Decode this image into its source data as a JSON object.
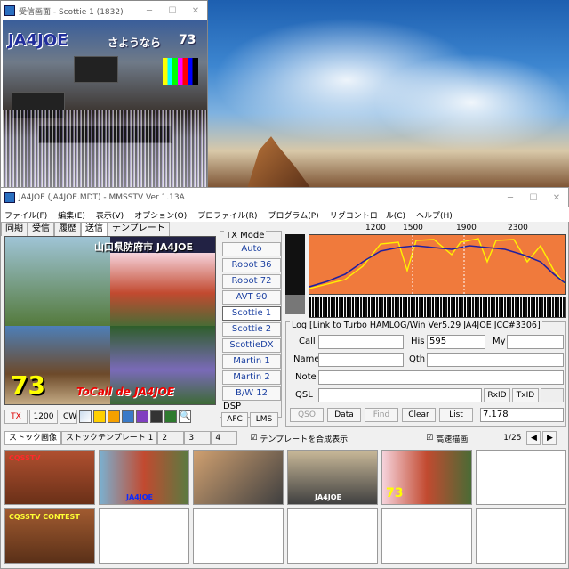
{
  "scottie_window": {
    "title": "受信画面 - Scottie 1 (1832)",
    "rx_text": "JA4JOE",
    "rx_text2": "さようなら",
    "rx_text3": "73"
  },
  "main_window": {
    "title": "JA4JOE (JA4JOE.MDT) - MMSSTV Ver 1.13A"
  },
  "menu": [
    "ファイル(F)",
    "編集(E)",
    "表示(V)",
    "オプション(O)",
    "プロファイル(R)",
    "プログラム(P)",
    "リグコントロール(C)",
    "ヘルプ(H)"
  ],
  "tabs": [
    "同期",
    "受信",
    "履歴",
    "送信",
    "テンプレート"
  ],
  "tx_image": {
    "title": "山口県防府市 JA4JOE",
    "big": "73",
    "tocall": "ToCall de JA4JOE"
  },
  "tx_controls": {
    "tx": "TX",
    "speed": "1200",
    "cw": "CW"
  },
  "tx_mode": {
    "label": "TX Mode",
    "modes": [
      "Auto",
      "Robot 36",
      "Robot 72",
      "AVT 90",
      "Scottie 1",
      "Scottie 2",
      "ScottieDX",
      "Martin 1",
      "Martin 2",
      "B/W 12"
    ]
  },
  "dsp": {
    "label": "DSP",
    "afc": "AFC",
    "lms": "LMS"
  },
  "freq_ticks": [
    "1200",
    "1500",
    "1900",
    "2300"
  ],
  "log": {
    "header": "Log [Link to Turbo HAMLOG/Win Ver5.29  JA4JOE JCC#3306]",
    "call": "Call",
    "his": "His",
    "his_value": "595",
    "my": "My",
    "name": "Name",
    "qth": "Qth",
    "note": "Note",
    "qsl": "QSL",
    "rxid": "RxID",
    "txid": "TxID",
    "qso": "QSO",
    "data": "Data",
    "find": "Find",
    "clear": "Clear",
    "list": "List",
    "freq": "7.178"
  },
  "stock": {
    "tabs": [
      "ストック画像",
      "ストックテンプレート 1",
      "2",
      "3",
      "4"
    ],
    "template_check": "テンプレートを合成表示",
    "fast_check": "高速描画",
    "page": "1/25"
  },
  "thumbs": [
    {
      "label": "CQSSTV",
      "color": "#ff2a2a"
    },
    {
      "label": "JA4JOE",
      "color": "#0a2aff"
    },
    {
      "label": "",
      "color": "#ff0"
    },
    {
      "label": "JA4JOE",
      "color": "#fff"
    },
    {
      "label": "73",
      "color": "#ff0"
    },
    {
      "label": "CQSSTV CONTEST",
      "color": "#ff3"
    }
  ]
}
